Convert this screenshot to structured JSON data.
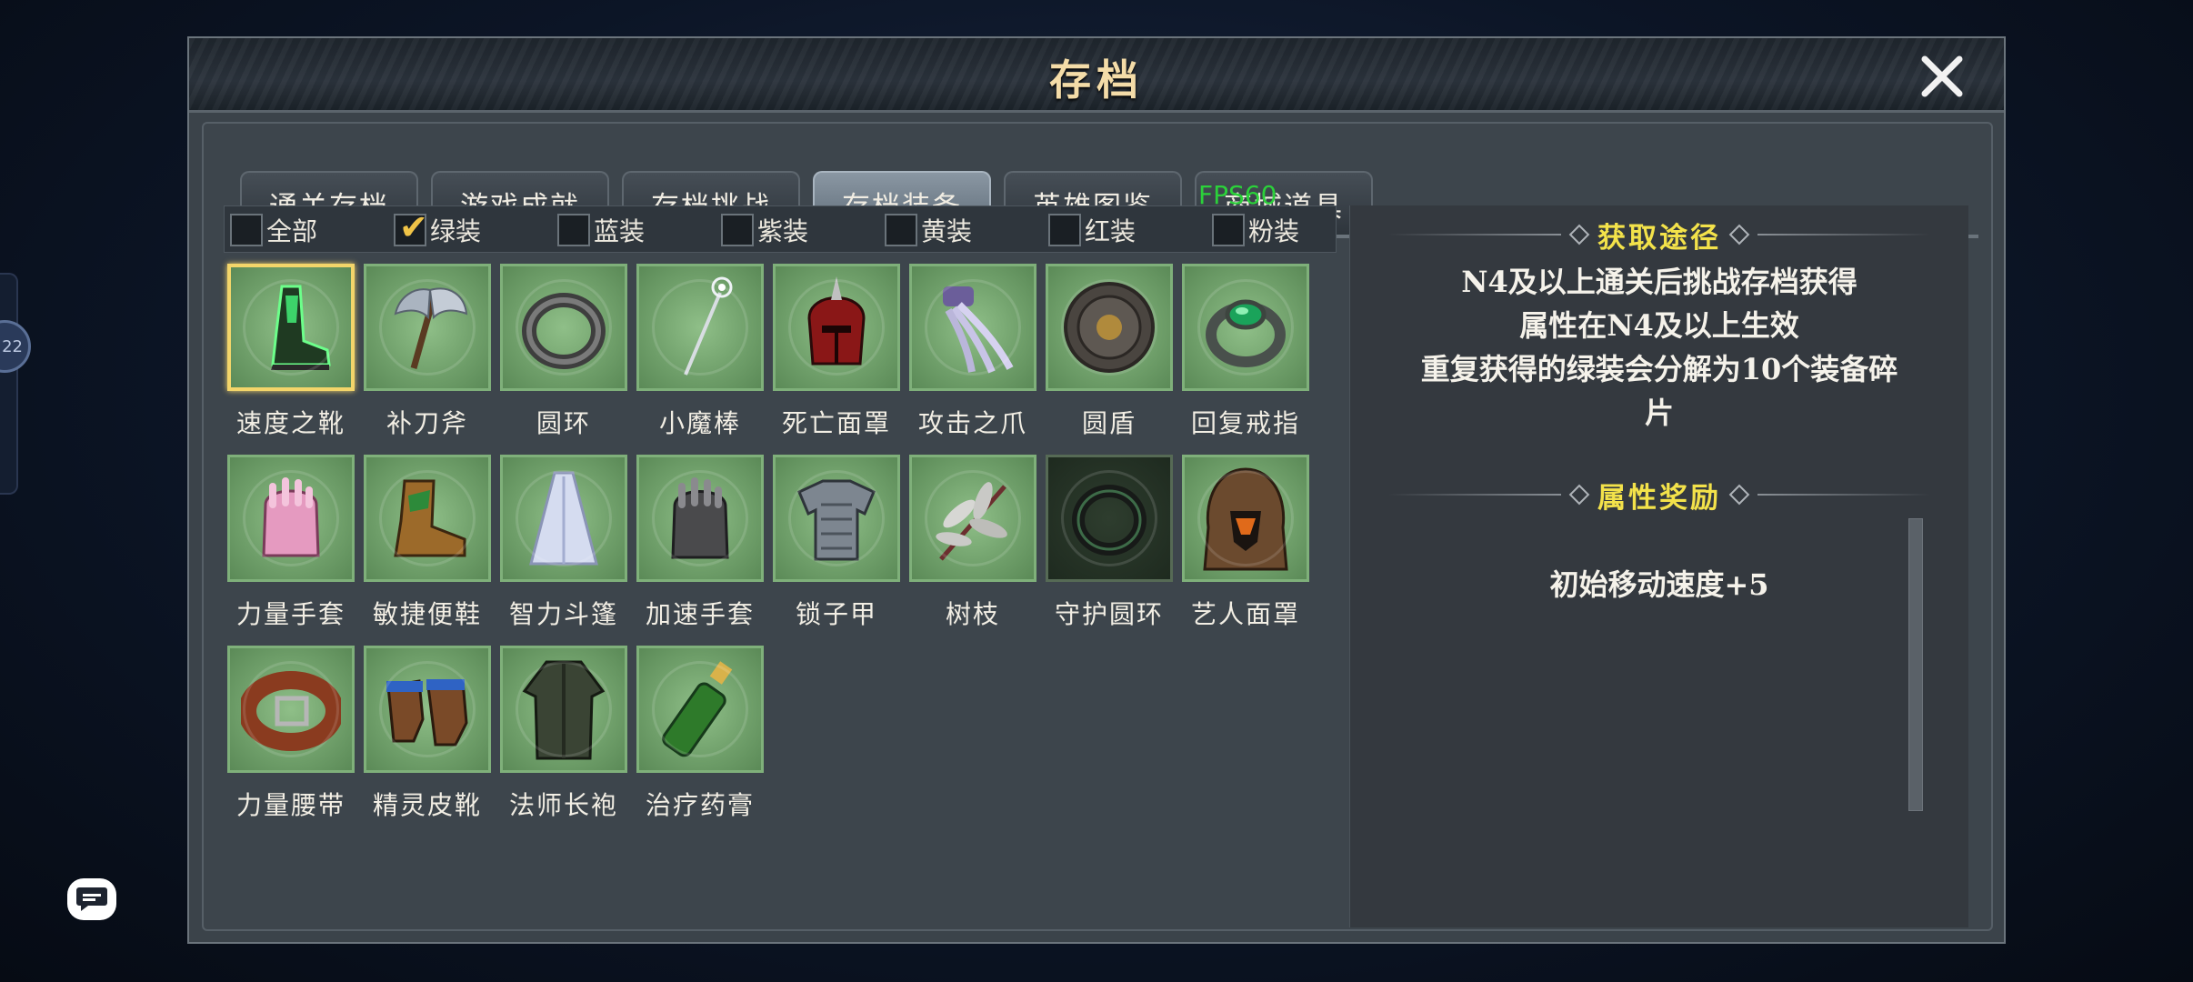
{
  "side": {
    "badge_text": "22"
  },
  "dialog": {
    "title": "存档"
  },
  "tabs": [
    {
      "label": "通关存档",
      "active": false
    },
    {
      "label": "游戏成就",
      "active": false
    },
    {
      "label": "存档挑战",
      "active": false
    },
    {
      "label": "存档装备",
      "active": true
    },
    {
      "label": "英雄图鉴",
      "active": false
    },
    {
      "label": "商城道具",
      "active": false
    }
  ],
  "fps_overlay": "FPS60",
  "filters": [
    {
      "label": "全部",
      "checked": false
    },
    {
      "label": "绿装",
      "checked": true
    },
    {
      "label": "蓝装",
      "checked": false
    },
    {
      "label": "紫装",
      "checked": false
    },
    {
      "label": "黄装",
      "checked": false
    },
    {
      "label": "红装",
      "checked": false
    },
    {
      "label": "粉装",
      "checked": false
    }
  ],
  "items": [
    {
      "name": "速度之靴",
      "icon": "boot-icon",
      "selected": true
    },
    {
      "name": "补刀斧",
      "icon": "axe-icon"
    },
    {
      "name": "圆环",
      "icon": "ring-icon"
    },
    {
      "name": "小魔棒",
      "icon": "wand-icon"
    },
    {
      "name": "死亡面罩",
      "icon": "helmet-icon"
    },
    {
      "name": "攻击之爪",
      "icon": "claw-icon"
    },
    {
      "name": "圆盾",
      "icon": "shield-icon"
    },
    {
      "name": "回复戒指",
      "icon": "emerald-ring-icon"
    },
    {
      "name": "力量手套",
      "icon": "pink-gauntlet-icon"
    },
    {
      "name": "敏捷便鞋",
      "icon": "slipper-icon"
    },
    {
      "name": "智力斗篷",
      "icon": "cloak-icon"
    },
    {
      "name": "加速手套",
      "icon": "gauntlet-icon"
    },
    {
      "name": "锁子甲",
      "icon": "chainmail-icon"
    },
    {
      "name": "树枝",
      "icon": "branch-icon"
    },
    {
      "name": "守护圆环",
      "icon": "guard-ring-icon",
      "dark": true
    },
    {
      "name": "艺人面罩",
      "icon": "hood-icon"
    },
    {
      "name": "力量腰带",
      "icon": "belt-icon"
    },
    {
      "name": "精灵皮靴",
      "icon": "leather-boot-icon"
    },
    {
      "name": "法师长袍",
      "icon": "robe-icon"
    },
    {
      "name": "治疗药膏",
      "icon": "salve-bottle-icon"
    }
  ],
  "detail": {
    "obtain_title": "获取途径",
    "obtain_lines": [
      "N4及以上通关后挑战存档获得",
      "属性在N4及以上生效",
      "重复获得的绿装会分解为10个装备碎",
      "片"
    ],
    "reward_title": "属性奖励",
    "reward_text": "初始移动速度+5"
  },
  "colors": {
    "title_gold": "#f4dca8",
    "section_yellow": "#f3e24a",
    "green_rarity": "#7fb07a",
    "selected_border": "#f3d56a",
    "fps_green": "#2bd13a"
  }
}
